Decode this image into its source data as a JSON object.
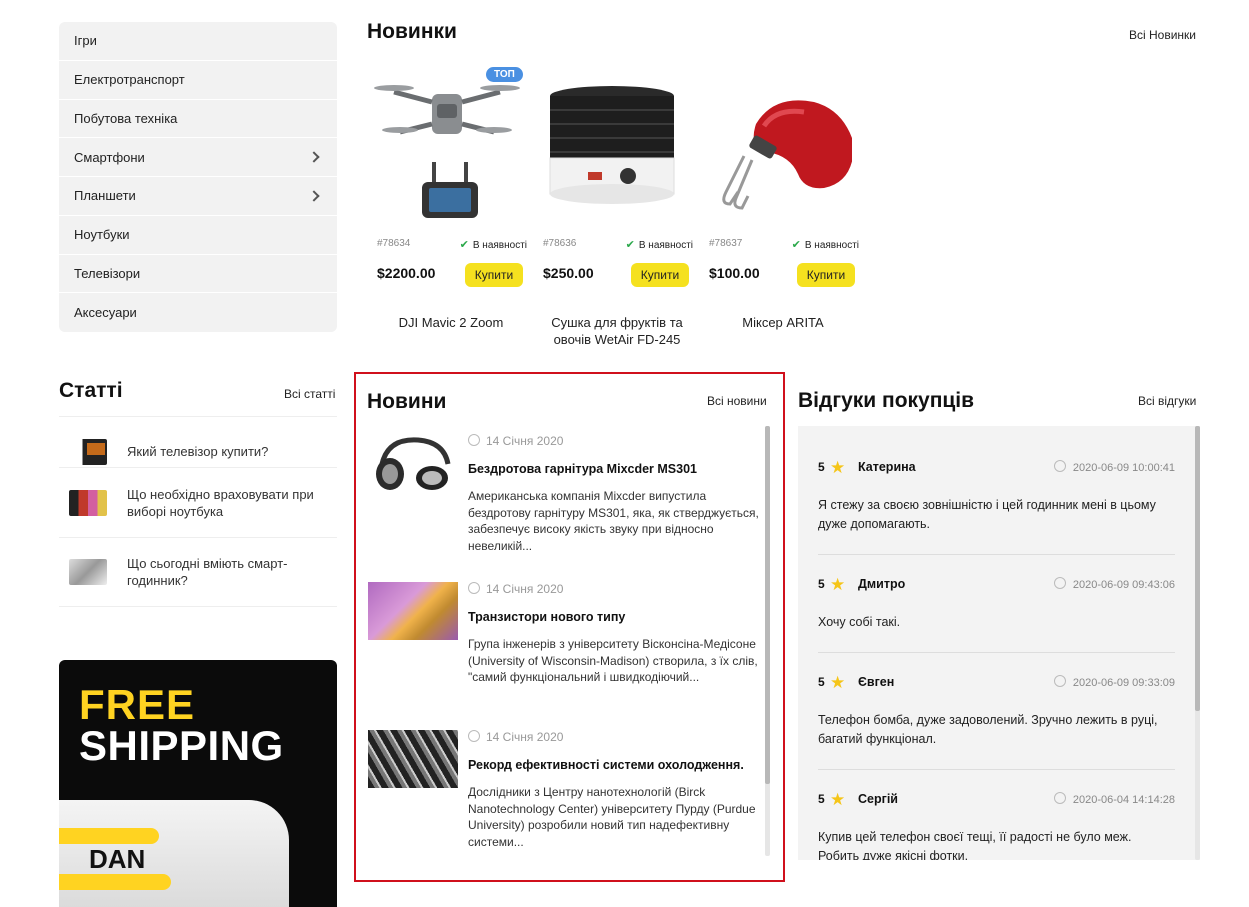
{
  "categories": [
    {
      "label": "Ігри"
    },
    {
      "label": "Електротранспорт"
    },
    {
      "label": "Побутова техніка"
    },
    {
      "label": "Смартфони"
    },
    {
      "label": "Планшети"
    },
    {
      "label": "Ноутбуки"
    },
    {
      "label": "Телевізори"
    },
    {
      "label": "Аксесуари"
    }
  ],
  "new_products": {
    "title": "Новинки",
    "all_label": "Всі Новинки",
    "badge": "ТОП",
    "items": [
      {
        "sku": "#78634",
        "availability": "В наявності",
        "price": "$2200.00",
        "buy_label": "Купити",
        "name": "DJI Mavic 2 Zoom"
      },
      {
        "sku": "#78636",
        "availability": "В наявності",
        "price": "$250.00",
        "buy_label": "Купити",
        "name": "Сушка для фруктів та овочів WetAir FD-245"
      },
      {
        "sku": "#78637",
        "availability": "В наявності",
        "price": "$100.00",
        "buy_label": "Купити",
        "name": "Міксер ARITA"
      }
    ]
  },
  "articles": {
    "title": "Статті",
    "all_label": "Всі статті",
    "items": [
      {
        "title": "Який телевізор купити?"
      },
      {
        "title": "Що необхідно враховувати при виборі ноутбука"
      },
      {
        "title": "Що сьогодні вміють смарт-годинник?"
      }
    ]
  },
  "banner": {
    "line1": "FREE",
    "line2": "SHIPPING",
    "brand": "DAN"
  },
  "news": {
    "title": "Новини",
    "all_label": "Всі новини",
    "items": [
      {
        "date": "14 Січня 2020",
        "title": "Бездротова гарнітура Mixcder MS301",
        "text": "Американська компанія Mixcder випустила бездротову гарнітуру MS301, яка, як стверджується, забезпечує високу якість звуку при відносно невеликій..."
      },
      {
        "date": "14 Січня 2020",
        "title": "Транзистори нового типу",
        "text": "Група інженерів з університету Вісконсіна-Медісоне (University of Wisconsin-Madison) створила, з їх слів, \"самий функціональний і швидкодіючий..."
      },
      {
        "date": "14 Січня 2020",
        "title": "Рекорд ефективності системи охолодження.",
        "text": "Дослідники з Центру нанотехнологій (Birck Nanotechnology Center) університету Пурду (Purdue University) розробили новий тип надефективну системи..."
      }
    ]
  },
  "reviews": {
    "title": "Відгуки покупців",
    "all_label": "Всі відгуки",
    "items": [
      {
        "rating": "5",
        "name": "Катерина",
        "date": "2020-06-09 10:00:41",
        "text": "Я стежу за своєю зовнішністю і цей годинник мені в цьому дуже допомагають."
      },
      {
        "rating": "5",
        "name": "Дмитро",
        "date": "2020-06-09 09:43:06",
        "text": "Хочу собі такі."
      },
      {
        "rating": "5",
        "name": "Євген",
        "date": "2020-06-09 09:33:09",
        "text": "Телефон бомба, дуже задоволений. Зручно лежить в руці, багатий функціонал."
      },
      {
        "rating": "5",
        "name": "Сергій",
        "date": "2020-06-04 14:14:28",
        "text": "Купив цей телефон своєї тещі, її радості не було меж. Робить дуже якісні фотки."
      }
    ]
  }
}
